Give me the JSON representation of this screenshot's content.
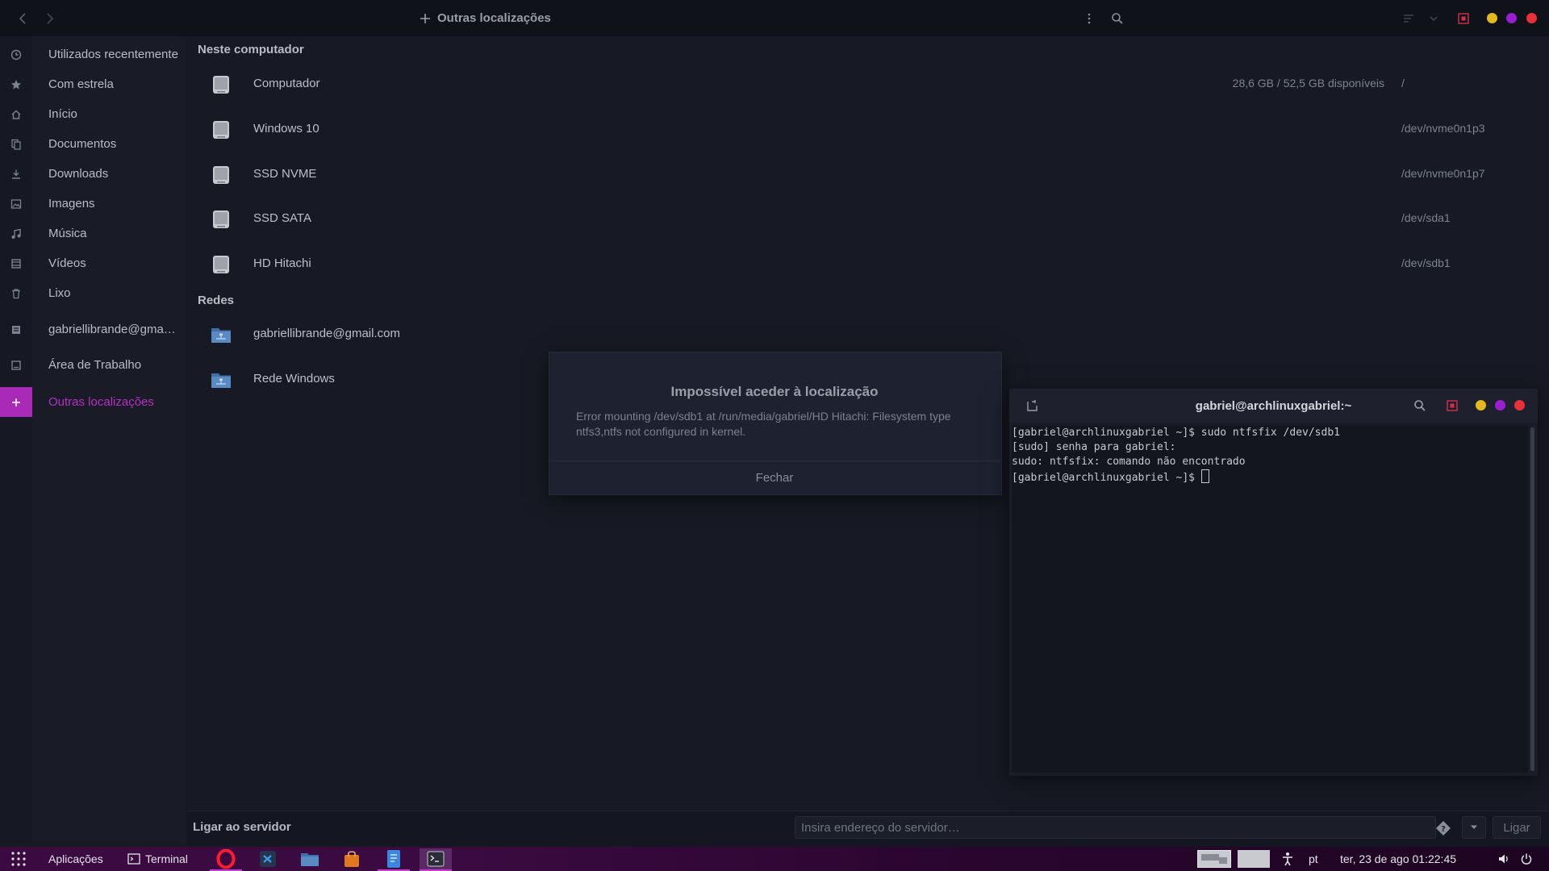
{
  "window": {
    "title": "Outras localizações"
  },
  "sidebar": {
    "items": [
      {
        "label": "Utilizados recentemente",
        "icon": "clock-icon"
      },
      {
        "label": "Com estrela",
        "icon": "star-icon"
      },
      {
        "label": "Início",
        "icon": "home-icon"
      },
      {
        "label": "Documentos",
        "icon": "document-icon"
      },
      {
        "label": "Downloads",
        "icon": "download-icon"
      },
      {
        "label": "Imagens",
        "icon": "image-icon"
      },
      {
        "label": "Música",
        "icon": "music-icon"
      },
      {
        "label": "Vídeos",
        "icon": "video-icon"
      },
      {
        "label": "Lixo",
        "icon": "trash-icon"
      },
      {
        "label": "gabriellibrande@gma…",
        "icon": "network-drive-icon"
      },
      {
        "label": "Área de Trabalho",
        "icon": "desktop-icon"
      },
      {
        "label": "Outras localizações",
        "icon": "plus-icon"
      }
    ]
  },
  "main": {
    "computer_section_title": "Neste computador",
    "drives": [
      {
        "name": "Computador",
        "info": "28,6 GB / 52,5 GB disponíveis",
        "path": "/"
      },
      {
        "name": "Windows 10",
        "info": "",
        "path": "/dev/nvme0n1p3"
      },
      {
        "name": "SSD NVME",
        "info": "",
        "path": "/dev/nvme0n1p7"
      },
      {
        "name": "SSD SATA",
        "info": "",
        "path": "/dev/sda1"
      },
      {
        "name": "HD Hitachi",
        "info": "",
        "path": "/dev/sdb1"
      }
    ],
    "network_section_title": "Redes",
    "networks": [
      {
        "name": "gabriellibrande@gmail.com"
      },
      {
        "name": "Rede Windows"
      }
    ]
  },
  "server_bar": {
    "label": "Ligar ao servidor",
    "placeholder": "Insira endereço do servidor…",
    "connect_label": "Ligar"
  },
  "dialog": {
    "title": "Impossível aceder à localização",
    "message": "Error mounting /dev/sdb1 at /run/media/gabriel/HD Hitachi: Filesystem type ntfs3,ntfs not configured in kernel.",
    "close_label": "Fechar"
  },
  "terminal": {
    "title": "gabriel@archlinuxgabriel:~",
    "lines": [
      "[gabriel@archlinuxgabriel ~]$ sudo ntfsfix /dev/sdb1",
      "[sudo] senha para gabriel:",
      "sudo: ntfsfix: comando não encontrado",
      "[gabriel@archlinuxgabriel ~]$ "
    ]
  },
  "taskbar": {
    "apps_label": "Aplicações",
    "terminal_label": "Terminal",
    "language": "pt",
    "clock": "ter, 23 de ago  01:22:45"
  },
  "colors": {
    "accent": "#a92ab7",
    "close_dot": "#e8303a",
    "minimize_dot": "#e3b920",
    "maximize_dot": "#9a1fd0"
  }
}
